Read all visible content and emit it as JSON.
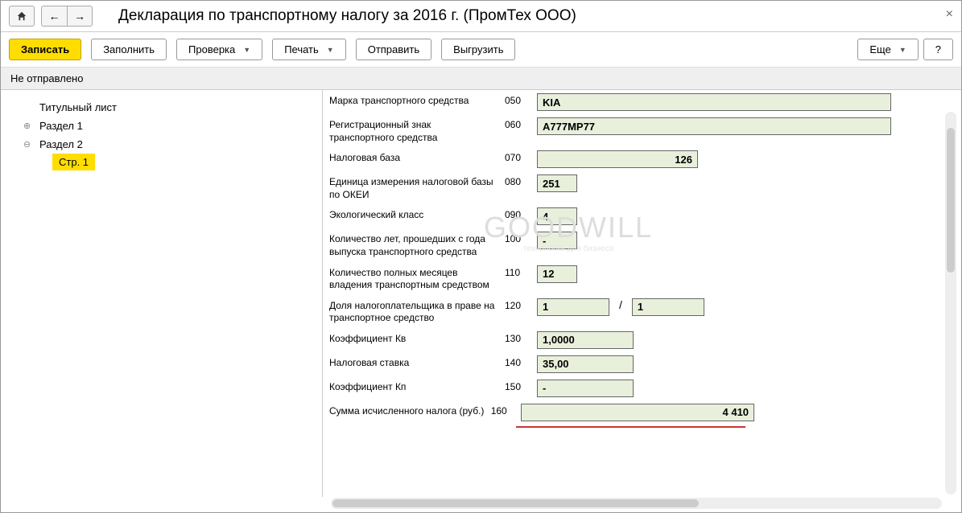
{
  "title": "Декларация по транспортному налогу за 2016 г. (ПромТех ООО)",
  "toolbar": {
    "save": "Записать",
    "fill": "Заполнить",
    "check": "Проверка",
    "print": "Печать",
    "send": "Отправить",
    "export": "Выгрузить",
    "more": "Еще",
    "help": "?"
  },
  "status": "Не отправлено",
  "tree": {
    "title_page": "Титульный лист",
    "section1": "Раздел 1",
    "section2": "Раздел 2",
    "page1": "Стр. 1"
  },
  "rows": {
    "r050": {
      "label": "Марка транспортного средства",
      "code": "050",
      "value": "KIA"
    },
    "r060": {
      "label": "Регистрационный знак транспортного средства",
      "code": "060",
      "value": "А777МР77"
    },
    "r070": {
      "label": "Налоговая база",
      "code": "070",
      "value": "126"
    },
    "r080": {
      "label": "Единица измерения налоговой базы по ОКЕИ",
      "code": "080",
      "value": "251"
    },
    "r090": {
      "label": "Экологический класс",
      "code": "090",
      "value": "4"
    },
    "r100": {
      "label": "Количество лет, прошедших с года выпуска транспортного средства",
      "code": "100",
      "value": "-"
    },
    "r110": {
      "label": "Количество полных месяцев владения транспортным средством",
      "code": "110",
      "value": "12"
    },
    "r120": {
      "label": "Доля налогоплательщика в праве на транспортное средство",
      "code": "120",
      "num": "1",
      "den": "1"
    },
    "r130": {
      "label": "Коэффициент Кв",
      "code": "130",
      "value": "1,0000"
    },
    "r140": {
      "label": "Налоговая ставка",
      "code": "140",
      "value": "35,00"
    },
    "r150": {
      "label": "Коэффициент Кп",
      "code": "150",
      "value": "-"
    },
    "r160": {
      "label": "Сумма исчисленного налога (руб.)",
      "code": "160",
      "value": "4 410"
    }
  },
  "watermark": {
    "main": "GOODWILL",
    "sub": "технологии для бизнеса"
  }
}
